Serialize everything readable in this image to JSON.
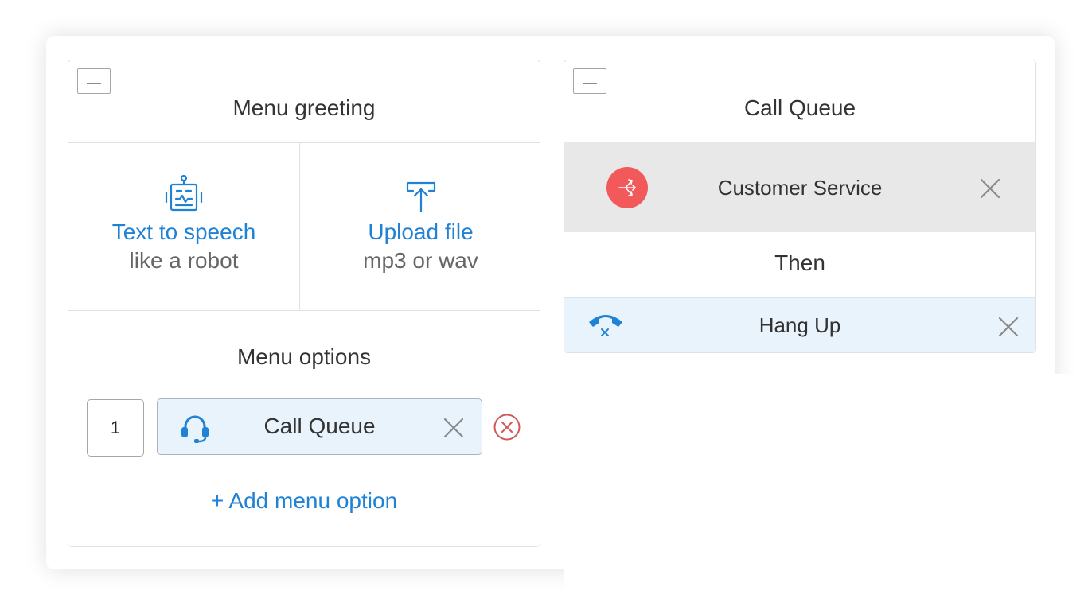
{
  "left_panel": {
    "minimize_label": "minimize",
    "greeting_title": "Menu greeting",
    "tts": {
      "title": "Text to speech",
      "subtitle": "like a robot",
      "icon": "robot-icon"
    },
    "upload": {
      "title": "Upload file",
      "subtitle": "mp3 or wav",
      "icon": "upload-icon"
    },
    "options_title": "Menu options",
    "option_row": {
      "key": "1",
      "action": "Call Queue",
      "icon": "headset-icon"
    },
    "add_option_label": "+ Add menu option"
  },
  "right_panel": {
    "title": "Call Queue",
    "queue": {
      "label": "Customer Service",
      "icon": "branch-icon",
      "badge_color": "#f1595a"
    },
    "then_label": "Then",
    "final_action": {
      "label": "Hang Up",
      "icon": "hang-up-icon"
    }
  },
  "colors": {
    "accent": "#1f82d5",
    "danger": "#d0575a",
    "selected_bg": "#e8f3fc",
    "grey_row_bg": "#e8e8e8"
  }
}
